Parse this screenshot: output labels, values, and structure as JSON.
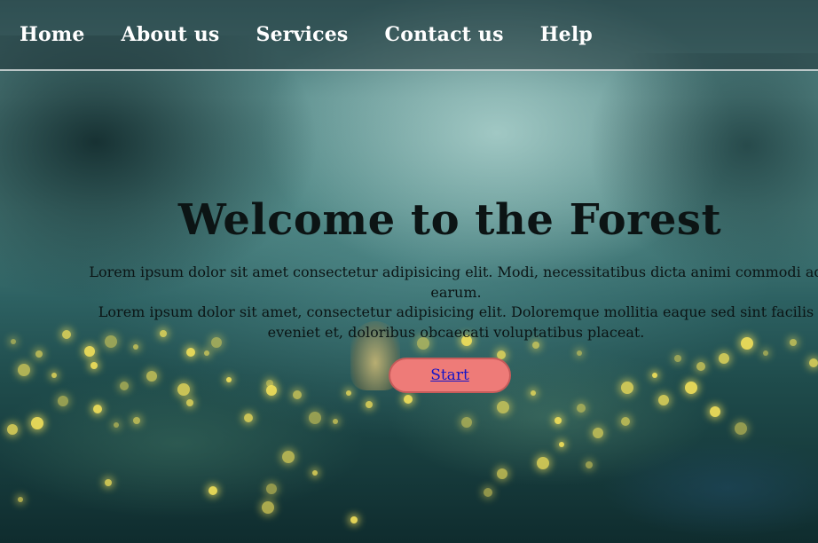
{
  "nav": {
    "items": [
      {
        "label": "Home"
      },
      {
        "label": "About us"
      },
      {
        "label": "Services"
      },
      {
        "label": "Contact us"
      },
      {
        "label": "Help"
      }
    ]
  },
  "hero": {
    "title": "Welcome to the Forest",
    "paragraph_1": "Lorem ipsum dolor sit amet consectetur adipisicing elit. Modi, necessitatibus dicta animi commodi ad earum.",
    "paragraph_2": "Lorem ipsum dolor sit amet, consectetur adipisicing elit. Doloremque mollitia eaque sed sint facilis eveniet et, doloribus obcaecati voluptatibus placeat.",
    "start_label": "Start"
  },
  "colors": {
    "button_background": "#ee7b78",
    "link_color": "#1414c8",
    "firefly": "#f6e35a"
  }
}
